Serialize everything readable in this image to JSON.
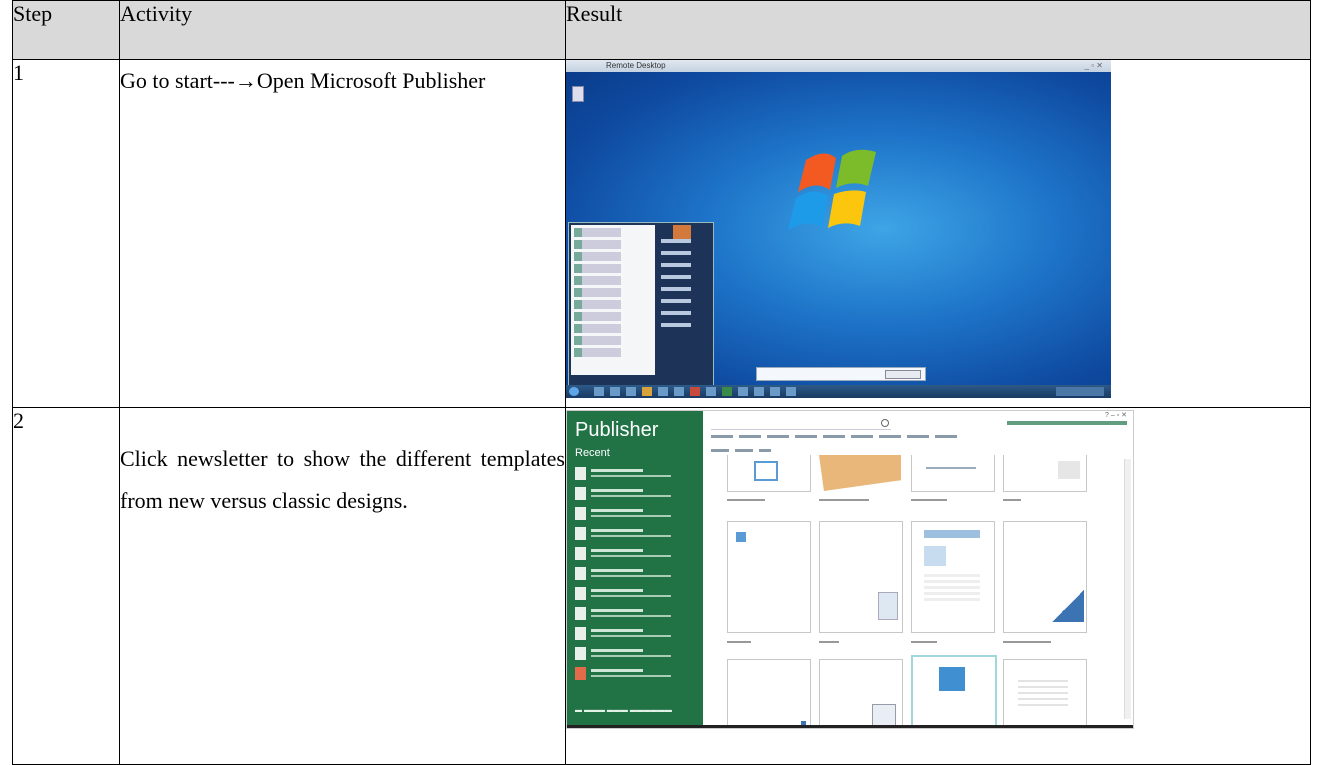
{
  "table": {
    "headers": {
      "step": "Step",
      "activity": "Activity",
      "result": "Result"
    },
    "rows": [
      {
        "step": "1",
        "activity": "Go to start---→Open Microsoft Publisher"
      },
      {
        "step": "2",
        "activity": "Click newsletter to show the different templates from new versus classic designs."
      }
    ]
  },
  "screenshot_desktop": {
    "title": "Remote Desktop"
  },
  "screenshot_publisher": {
    "app_title": "Publisher",
    "recent_heading": "Recent"
  },
  "colors": {
    "header_bg": "#d9d9d9",
    "publisher_green": "#217346",
    "desktop_blue": "#1d73c8"
  },
  "icons": {
    "windows_logo": "windows-logo-icon",
    "start_orb": "start-orb-icon"
  }
}
